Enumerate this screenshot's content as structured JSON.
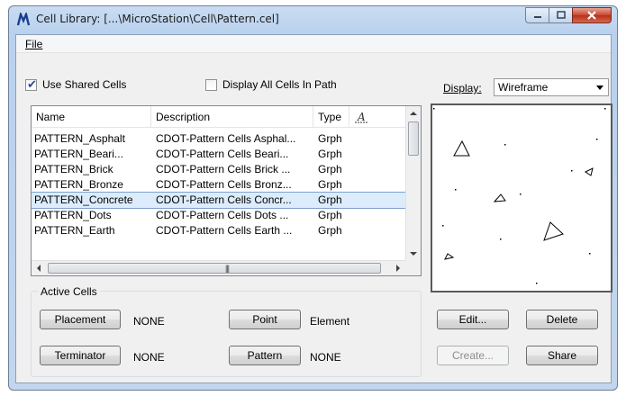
{
  "window": {
    "title": "Cell Library: [...\\MicroStation\\Cell\\Pattern.cel]",
    "controls": {
      "minimize": "minimize",
      "maximize": "maximize",
      "close": "close"
    }
  },
  "menu": {
    "file": "File"
  },
  "options": {
    "use_shared_cells": {
      "label": "Use Shared Cells",
      "checked": true
    },
    "display_all_cells": {
      "label": "Display All Cells In Path",
      "checked": false
    }
  },
  "display": {
    "label": "Display:",
    "value": "Wireframe"
  },
  "list": {
    "columns": [
      "Name",
      "Description",
      "Type"
    ],
    "rows": [
      {
        "name": "PATTERN_Asphalt",
        "description": "CDOT-Pattern Cells Asphal...",
        "type": "Grph"
      },
      {
        "name": "PATTERN_Beari...",
        "description": "CDOT-Pattern Cells Beari...",
        "type": "Grph"
      },
      {
        "name": "PATTERN_Brick",
        "description": "CDOT-Pattern Cells Brick ...",
        "type": "Grph"
      },
      {
        "name": "PATTERN_Bronze",
        "description": "CDOT-Pattern Cells Bronz...",
        "type": "Grph"
      },
      {
        "name": "PATTERN_Concrete",
        "description": "CDOT-Pattern Cells Concr...",
        "type": "Grph",
        "selected": true
      },
      {
        "name": "PATTERN_Dots",
        "description": "CDOT-Pattern Cells Dots ...",
        "type": "Grph"
      },
      {
        "name": "PATTERN_Earth",
        "description": "CDOT-Pattern Cells Earth ...",
        "type": "Grph"
      }
    ]
  },
  "active_cells": {
    "title": "Active Cells",
    "placement": {
      "button": "Placement",
      "value": "NONE"
    },
    "point": {
      "button": "Point",
      "value": "Element"
    },
    "terminator": {
      "button": "Terminator",
      "value": "NONE"
    },
    "pattern": {
      "button": "Pattern",
      "value": "NONE"
    }
  },
  "actions": {
    "edit": "Edit...",
    "delete": "Delete",
    "create": "Create...",
    "share": "Share"
  },
  "colors": {
    "selection": "#dcecfc",
    "title_bar": "#c9dcf2",
    "close_button": "#c9452e"
  }
}
